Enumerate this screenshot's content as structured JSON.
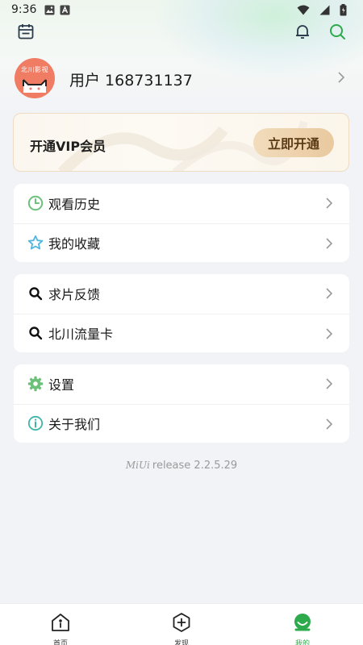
{
  "status_bar": {
    "time": "9:36"
  },
  "header": {
    "icons": [
      "calendar-icon",
      "bell-icon",
      "search-icon"
    ]
  },
  "profile": {
    "avatar_text": "北川影视",
    "username": "用户 168731137"
  },
  "vip": {
    "title": "开通VIP会员",
    "button_label": "立即开通"
  },
  "menu_groups": [
    [
      {
        "label": "观看历史",
        "icon": "clock-icon"
      },
      {
        "label": "我的收藏",
        "icon": "star-icon"
      }
    ],
    [
      {
        "label": "求片反馈",
        "icon": "search-icon"
      },
      {
        "label": "北川流量卡",
        "icon": "search-icon"
      }
    ],
    [
      {
        "label": "设置",
        "icon": "gear-icon"
      },
      {
        "label": "关于我们",
        "icon": "info-icon"
      }
    ]
  ],
  "version": {
    "brand": "MiUi",
    "text": "release 2.2.5.29"
  },
  "bottom_nav": [
    {
      "label": "首页",
      "icon": "home-icon",
      "active": false
    },
    {
      "label": "发现",
      "icon": "discover-icon",
      "active": false
    },
    {
      "label": "我的",
      "icon": "profile-icon",
      "active": true
    }
  ],
  "colors": {
    "accent": "#2daa4b",
    "vip_button": "#e9c99f",
    "clock_icon": "#6cc17a",
    "star_icon": "#4fb6e0",
    "gear_icon": "#6cc17a",
    "info_icon": "#3fb5a9"
  }
}
